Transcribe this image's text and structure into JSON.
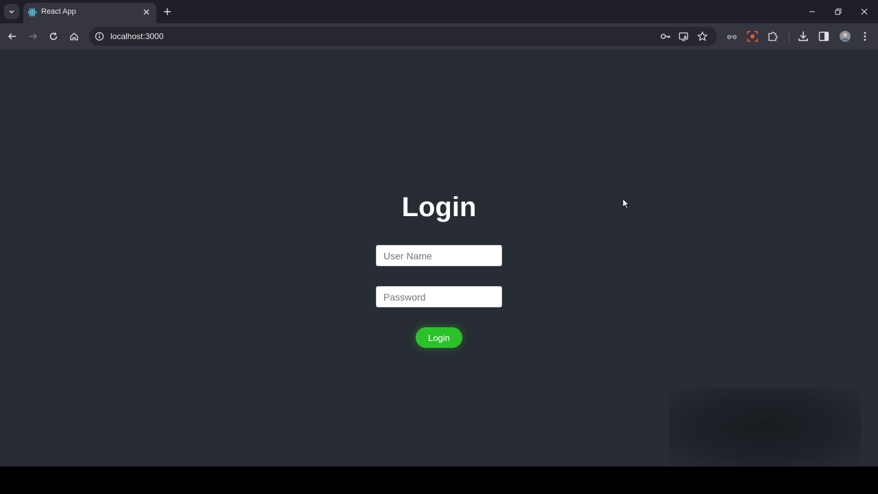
{
  "browser": {
    "tab_title": "React App",
    "url": "localhost:3000"
  },
  "login": {
    "title": "Login",
    "username_placeholder": "User Name",
    "password_placeholder": "Password",
    "submit_label": "Login"
  },
  "colors": {
    "page_bg": "#282c34",
    "button_green": "#2cc12a",
    "chrome_dark": "#1f1e29",
    "chrome_toolbar": "#35363f"
  }
}
